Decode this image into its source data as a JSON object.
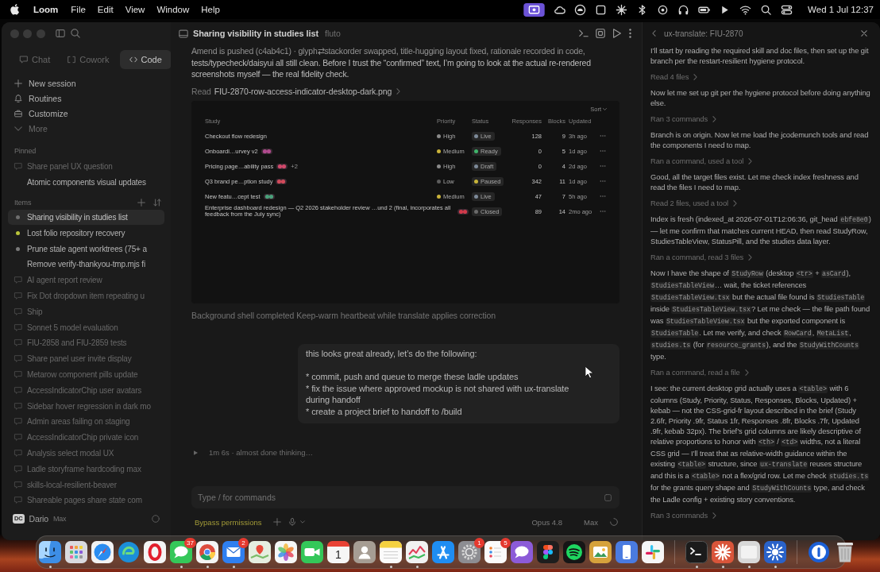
{
  "menubar": {
    "app_name": "Loom",
    "menus": [
      "File",
      "Edit",
      "View",
      "Window",
      "Help"
    ],
    "status_items": [
      {
        "kind": "screen",
        "highlighted": true
      },
      {
        "kind": "cloud",
        "highlighted": false
      },
      {
        "kind": "disc",
        "highlighted": false
      },
      {
        "kind": "square",
        "highlighted": false
      },
      {
        "kind": "spark",
        "highlighted": false
      },
      {
        "kind": "bluetooth",
        "highlighted": false
      },
      {
        "kind": "target",
        "highlighted": false
      },
      {
        "kind": "headphones",
        "highlighted": false
      },
      {
        "kind": "battery",
        "highlighted": false
      },
      {
        "kind": "play",
        "highlighted": false
      },
      {
        "kind": "wifi",
        "highlighted": false
      },
      {
        "kind": "search",
        "highlighted": false
      },
      {
        "kind": "toggles",
        "highlighted": false
      }
    ],
    "clock": "Wed 1 Jul 12:37"
  },
  "sidebar": {
    "tabs": [
      {
        "label": "Chat",
        "kind": "chat",
        "selected": false
      },
      {
        "label": "Cowork",
        "kind": "cowork",
        "selected": false
      },
      {
        "label": "Code",
        "kind": "code",
        "selected": true
      }
    ],
    "nav": [
      {
        "label": "New session",
        "kind": "plus",
        "dimmed": false
      },
      {
        "label": "Routines",
        "kind": "routine",
        "dimmed": false
      },
      {
        "label": "Customize",
        "kind": "toolbox",
        "dimmed": false
      },
      {
        "label": "More",
        "kind": "more",
        "dimmed": true
      }
    ],
    "pinned": {
      "heading": "Pinned",
      "items": [
        {
          "label": "Share panel UX question",
          "kind": "bubble",
          "dimmed": true,
          "selected": false
        },
        {
          "label": "Atomic components visual updates",
          "kind": "plain",
          "dimmed": false,
          "selected": false
        }
      ]
    },
    "recents": {
      "heading": "Items",
      "items": [
        {
          "label": "Sharing visibility in studies list",
          "kind": "dot",
          "color": "#6e6e6e",
          "dimmed": false,
          "selected": true
        },
        {
          "label": "Lost folio repository recovery",
          "kind": "dot",
          "color": "#b9c43a",
          "dimmed": false,
          "selected": false
        },
        {
          "label": "Prune stale agent worktrees (75+ a",
          "kind": "dot",
          "color": "#7a7a7a",
          "dimmed": false,
          "selected": false
        },
        {
          "label": "Remove verify-thankyou-tmp.mjs fi",
          "kind": "plain",
          "dimmed": false,
          "selected": false
        },
        {
          "label": "AI agent report review",
          "kind": "bubble",
          "dimmed": true,
          "selected": false
        },
        {
          "label": "Fix Dot dropdown item repeating u",
          "kind": "bubble",
          "dimmed": true,
          "selected": false
        },
        {
          "label": "Ship",
          "kind": "bubble",
          "dimmed": true,
          "selected": false
        },
        {
          "label": "Sonnet 5 model evaluation",
          "kind": "bubble",
          "dimmed": true,
          "selected": false
        },
        {
          "label": "FIU-2858 and FIU-2859 tests",
          "kind": "bubble",
          "dimmed": true,
          "selected": false
        },
        {
          "label": "Share panel user invite display",
          "kind": "bubble",
          "dimmed": true,
          "selected": false
        },
        {
          "label": "Metarow component pills update",
          "kind": "bubble",
          "dimmed": true,
          "selected": false
        },
        {
          "label": "AccessIndicatorChip user avatars",
          "kind": "bubble",
          "dimmed": true,
          "selected": false
        },
        {
          "label": "Sidebar hover regression in dark mo",
          "kind": "bubble",
          "dimmed": true,
          "selected": false
        },
        {
          "label": "Admin areas failing on staging",
          "kind": "bubble",
          "dimmed": true,
          "selected": false
        },
        {
          "label": "AccessIndicatorChip private icon",
          "kind": "bubble",
          "dimmed": true,
          "selected": false
        },
        {
          "label": "Analysis select modal UX",
          "kind": "bubble",
          "dimmed": true,
          "selected": false
        },
        {
          "label": "Ladle storyframe hardcoding max",
          "kind": "bubble",
          "dimmed": true,
          "selected": false
        },
        {
          "label": "skills-local-resilient-beaver",
          "kind": "bubble",
          "dimmed": true,
          "selected": false
        },
        {
          "label": "Shareable pages share state com",
          "kind": "bubble",
          "dimmed": true,
          "selected": false
        }
      ]
    },
    "user": {
      "initials": "DC",
      "name": "Dario",
      "plan": "Max"
    }
  },
  "main": {
    "header": {
      "title": "Sharing visibility in studies list",
      "branch": "fluto"
    },
    "messages": [
      {
        "kind": "text",
        "text": "Amend is pushed (c4ab4c1) · glyph⇄stackorder swapped, title-hugging layout fixed, rationale recorded in code, tests/typecheck/daisyui all still clean. Before I trust the “confirmed” text, I’m going to look at the actual re-rendered screenshots myself — the real fidelity check."
      },
      {
        "kind": "tool",
        "verb": "Read",
        "target": "FIU-2870-row-access-indicator-desktop-dark.png"
      },
      {
        "kind": "preview",
        "sort_label": "Sort",
        "columns": [
          "Study",
          "Priority",
          "Status",
          "Responses",
          "Blocks",
          "Updated"
        ],
        "rows": [
          {
            "name": "Checkout flow redesign",
            "chips": [],
            "priority": {
              "label": "High",
              "color": "#8a8a8a"
            },
            "status": {
              "label": "Live",
              "color": "#7d8a99"
            },
            "responses": "128",
            "blocks": "9",
            "updated": "3h ago"
          },
          {
            "name": "Onboardi…urvey v2",
            "chips": [
              {
                "color": "#b04a8e"
              }
            ],
            "priority": {
              "label": "Medium",
              "color": "#c9b23a"
            },
            "status": {
              "label": "Ready",
              "color": "#3fb36a"
            },
            "responses": "0",
            "blocks": "5",
            "updated": "1d ago"
          },
          {
            "name": "Pricing page…ability pass",
            "chips": [
              {
                "color": "#d0486a"
              }
            ],
            "extra": "+2",
            "priority": {
              "label": "High",
              "color": "#8a8a8a"
            },
            "status": {
              "label": "Draft",
              "color": "#7d8a99"
            },
            "responses": "0",
            "blocks": "4",
            "updated": "2d ago"
          },
          {
            "name": "Q3 brand pe…ption study",
            "chips": [
              {
                "color": "#d04a5a"
              }
            ],
            "priority": {
              "label": "Low",
              "color": "#5c5c5c"
            },
            "status": {
              "label": "Paused",
              "color": "#c8b53a"
            },
            "responses": "342",
            "blocks": "11",
            "updated": "1d ago"
          },
          {
            "name": "New featu…cept test",
            "chips": [
              {
                "color": "#4aa07a"
              }
            ],
            "priority": {
              "label": "Medium",
              "color": "#c9b23a"
            },
            "status": {
              "label": "Live",
              "color": "#7d8a99"
            },
            "responses": "47",
            "blocks": "7",
            "updated": "5h ago"
          },
          {
            "name": "Enterprise dashboard redesign — Q2 2026 stakeholder review …und 2 (final, incorporates all feedback from the July sync)",
            "chips": [
              {
                "color": "#d03a4a"
              }
            ],
            "status": {
              "label": "Closed",
              "color": "#6a6a6a"
            },
            "responses": "89",
            "blocks": "14",
            "updated": "2mo ago"
          }
        ]
      },
      {
        "kind": "status",
        "text": "Background shell completed Keep-warm heartbeat while translate applies correction"
      },
      {
        "kind": "user",
        "text": "this looks great already, let’s do the following:\n\n* commit, push and queue to merge these ladle updates\n* fix the issue where approved mockup is not shared with ux-translate during handoff\n* create a project brief to handoff to /build"
      },
      {
        "kind": "thinking",
        "text": "1m 6s · almost done thinking…"
      }
    ],
    "composer": {
      "placeholder": "Type / for commands"
    },
    "footer": {
      "mode": "Bypass permissions",
      "model": "Opus 4.8",
      "effort": "Max"
    }
  },
  "agent_panel": {
    "title": "ux-translate: FIU-2870",
    "entries": [
      {
        "kind": "text",
        "segments": [
          {
            "text": "I’ll start by reading the required skill and doc files, then set up the git branch per the restart-resilient hygiene protocol.",
            "kind": "prose"
          }
        ]
      },
      {
        "kind": "tool",
        "text": "Read 4 files"
      },
      {
        "kind": "text",
        "segments": [
          {
            "text": "Now let me set up git per the hygiene protocol before doing anything else.",
            "kind": "prose"
          }
        ]
      },
      {
        "kind": "tool",
        "text": "Ran 3 commands"
      },
      {
        "kind": "text",
        "segments": [
          {
            "text": "Branch is on origin. Now let me load the jcodemunch tools and read the components I need to map.",
            "kind": "prose"
          }
        ]
      },
      {
        "kind": "tool",
        "text": "Ran a command, used a tool"
      },
      {
        "kind": "text",
        "segments": [
          {
            "text": "Good, all the target files exist. Let me check index freshness and read the files I need to map.",
            "kind": "prose"
          }
        ]
      },
      {
        "kind": "tool",
        "text": "Read 2 files, used a tool"
      },
      {
        "kind": "text",
        "segments": [
          {
            "text": "Index is fresh (indexed_at 2026-07-01T12:06:36, git_head ",
            "kind": "prose"
          },
          {
            "text": "ebfe8e0",
            "kind": "code"
          },
          {
            "text": ") — let me confirm that matches current HEAD, then read StudyRow, StudiesTableView, StatusPill, and the studies data layer.",
            "kind": "prose"
          }
        ]
      },
      {
        "kind": "tool",
        "text": "Ran a command, read 3 files"
      },
      {
        "kind": "text",
        "segments": [
          {
            "text": "Now I have the shape of ",
            "kind": "prose"
          },
          {
            "text": "StudyRow",
            "kind": "code"
          },
          {
            "text": " (desktop ",
            "kind": "prose"
          },
          {
            "text": "<tr>",
            "kind": "code"
          },
          {
            "text": " + ",
            "kind": "prose"
          },
          {
            "text": "asCard",
            "kind": "code"
          },
          {
            "text": "), ",
            "kind": "prose"
          },
          {
            "text": "StudiesTableView",
            "kind": "code"
          },
          {
            "text": "… wait, the ticket references ",
            "kind": "prose"
          },
          {
            "text": "StudiesTableView.tsx",
            "kind": "code"
          },
          {
            "text": " but the actual file found is ",
            "kind": "prose"
          },
          {
            "text": "StudiesTable",
            "kind": "code"
          },
          {
            "text": " inside ",
            "kind": "prose"
          },
          {
            "text": "StudiesTableView.tsx",
            "kind": "code"
          },
          {
            "text": "? Let me check — the file path found was ",
            "kind": "prose"
          },
          {
            "text": "StudiesTableView.tsx",
            "kind": "code"
          },
          {
            "text": " but the exported component is ",
            "kind": "prose"
          },
          {
            "text": "StudiesTable",
            "kind": "code"
          },
          {
            "text": ". Let me verify, and check ",
            "kind": "prose"
          },
          {
            "text": "RowCard",
            "kind": "code"
          },
          {
            "text": ", ",
            "kind": "prose"
          },
          {
            "text": "MetaList",
            "kind": "code"
          },
          {
            "text": ", ",
            "kind": "prose"
          },
          {
            "text": "studies.ts",
            "kind": "code"
          },
          {
            "text": " (for ",
            "kind": "prose"
          },
          {
            "text": "resource_grants",
            "kind": "code"
          },
          {
            "text": "), and the ",
            "kind": "prose"
          },
          {
            "text": "StudyWithCounts",
            "kind": "code"
          },
          {
            "text": " type.",
            "kind": "prose"
          }
        ]
      },
      {
        "kind": "tool",
        "text": "Ran a command, read a file"
      },
      {
        "kind": "text",
        "segments": [
          {
            "text": "I see: the current desktop grid actually uses a ",
            "kind": "prose"
          },
          {
            "text": "<table>",
            "kind": "code"
          },
          {
            "text": " with 6 columns (Study, Priority, Status, Responses, Blocks, Updated) + kebab — not the CSS-grid-fr layout described in the brief (Study 2.6fr, Priority .9fr, Status 1fr, Responses .8fr, Blocks .7fr, Updated .9fr, kebab 32px). The brief’s grid columns are likely descriptive of relative proportions to honor with ",
            "kind": "prose"
          },
          {
            "text": "<th>",
            "kind": "code"
          },
          {
            "text": " / ",
            "kind": "prose"
          },
          {
            "text": "<td>",
            "kind": "code"
          },
          {
            "text": " widths, not a literal CSS grid — I’ll treat that as relative-width guidance within the existing ",
            "kind": "prose"
          },
          {
            "text": "<table>",
            "kind": "code"
          },
          {
            "text": " structure, since ",
            "kind": "prose"
          },
          {
            "text": "ux-translate",
            "kind": "code"
          },
          {
            "text": " reuses structure and this is a ",
            "kind": "prose"
          },
          {
            "text": "<table>",
            "kind": "code"
          },
          {
            "text": " not a flex/grid row. Let me check ",
            "kind": "prose"
          },
          {
            "text": "studies.ts",
            "kind": "code"
          },
          {
            "text": " for the grants query shape and ",
            "kind": "prose"
          },
          {
            "text": "StudyWithCounts",
            "kind": "code"
          },
          {
            "text": " type, and check the Ladle config + existing story conventions.",
            "kind": "prose"
          }
        ]
      },
      {
        "kind": "tool",
        "text": "Ran 3 commands"
      }
    ]
  },
  "dock": {
    "groups": [
      [
        {
          "kind": "finder",
          "color": "#3d8ee6",
          "running": true
        },
        {
          "kind": "grid",
          "color": "#dadadf",
          "running": false
        },
        {
          "kind": "compass",
          "color": "#f2f2f2",
          "running": false
        },
        {
          "kind": "swirl",
          "color": "#1c8ed8",
          "running": false
        },
        {
          "kind": "ring",
          "color": "#f4f4f4",
          "running": false
        },
        {
          "kind": "bubble",
          "color": "#35c759",
          "running": true,
          "badge": "37"
        },
        {
          "kind": "wheel",
          "color": "#f4f4f4",
          "running": true
        },
        {
          "kind": "envelope",
          "color": "#2f7ff0",
          "running": true,
          "badge": "2"
        },
        {
          "kind": "pin",
          "color": "#e6eee0",
          "running": false
        },
        {
          "kind": "flower",
          "color": "#f6f6f6",
          "running": false
        },
        {
          "kind": "camera",
          "color": "#34c759",
          "running": false
        },
        {
          "kind": "calendar",
          "color": "#f6f6f6",
          "running": false,
          "label": "1"
        },
        {
          "kind": "person",
          "color": "#a69d93",
          "running": false
        },
        {
          "kind": "notepad",
          "color": "#fbfbfb",
          "running": true
        },
        {
          "kind": "graph",
          "color": "#f1f1f1",
          "running": true
        },
        {
          "kind": "astore",
          "color": "#1f8df2",
          "running": false
        },
        {
          "kind": "gear",
          "color": "#8d8d92",
          "running": false,
          "badge": "1"
        },
        {
          "kind": "checklist",
          "color": "#fbfbfb",
          "running": false,
          "badge": "5"
        },
        {
          "kind": "bubble",
          "color": "#8c5bd8",
          "running": false
        },
        {
          "kind": "shapes",
          "color": "#1e1e1e",
          "running": false
        },
        {
          "kind": "waves",
          "color": "#161616",
          "running": false
        },
        {
          "kind": "landscape",
          "color": "#d6a23c",
          "running": false
        },
        {
          "kind": "device",
          "color": "#4a7be0",
          "running": false
        },
        {
          "kind": "pinwheel",
          "color": "#f6f6f6",
          "running": false
        }
      ],
      [
        {
          "kind": "terminal",
          "color": "#1b1b1b",
          "running": true
        },
        {
          "kind": "starburst",
          "color": "#d9553a",
          "running": true
        },
        {
          "kind": "blank",
          "color": "#d8d8d8",
          "running": true
        },
        {
          "kind": "sunburst",
          "color": "#2a62c9",
          "running": true
        }
      ],
      [
        {
          "kind": "keyhole",
          "color": "#1b5fd6",
          "running": false
        },
        {
          "kind": "trash",
          "color": "#c4c4c4",
          "running": false
        }
      ]
    ]
  }
}
